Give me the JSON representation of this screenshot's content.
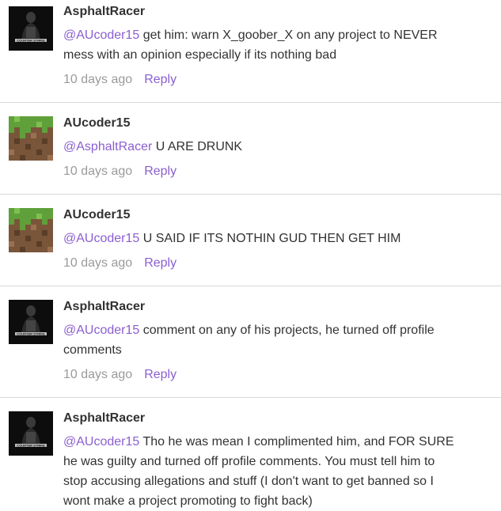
{
  "comments": [
    {
      "author": "AsphaltRacer",
      "avatar": "counter-strike-avatar",
      "mention": "@AUcoder15",
      "text": "get him: warn X_goober_X on any project to NEVER mess with an opinion especially if its nothing bad",
      "time": "10 days ago",
      "reply_label": "Reply"
    },
    {
      "author": "AUcoder15",
      "avatar": "minecraft-grass-block-avatar",
      "mention": "@AsphaltRacer",
      "text": "U ARE DRUNK",
      "time": "10 days ago",
      "reply_label": "Reply"
    },
    {
      "author": "AUcoder15",
      "avatar": "minecraft-grass-block-avatar",
      "mention": "@AUcoder15",
      "text": "U SAID IF ITS NOTHIN GUD THEN GET HIM",
      "time": "10 days ago",
      "reply_label": "Reply"
    },
    {
      "author": "AsphaltRacer",
      "avatar": "counter-strike-avatar",
      "mention": "@AUcoder15",
      "text": "comment on any of his projects, he turned off profile comments",
      "time": "10 days ago",
      "reply_label": "Reply"
    },
    {
      "author": "AsphaltRacer",
      "avatar": "counter-strike-avatar",
      "mention": "@AUcoder15",
      "text": "Tho he was mean I complimented him, and FOR SURE he was guilty and turned off profile comments. You must tell him to stop accusing allegations and stuff (I don't want to get banned so I wont make a project promoting to fight back)",
      "time": "",
      "reply_label": ""
    }
  ],
  "avatar_logo_text": "COUNTER STRIKE"
}
